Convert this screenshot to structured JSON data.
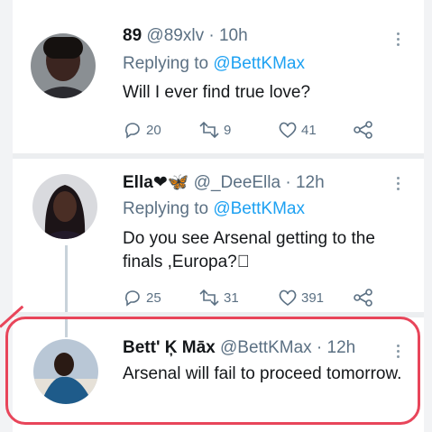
{
  "tweets": [
    {
      "name": "89",
      "handle": "@89xlv",
      "time": "10h",
      "reply_prefix": "Replying to",
      "reply_to": "@BettKMax",
      "text": "Will I ever find true love?",
      "actions": {
        "replies": "20",
        "retweets": "9",
        "likes": "41"
      }
    },
    {
      "name": "Ella",
      "name_emoji": "❤🦋",
      "handle": "@_DeeElla",
      "time": "12h",
      "reply_prefix": "Replying to",
      "reply_to": "@BettKMax",
      "text": "Do you see Arsenal getting to the finals ,Europa?\u0000",
      "actions": {
        "replies": "25",
        "retweets": "31",
        "likes": "391"
      }
    },
    {
      "name": "Bett' Ķ Māx",
      "handle": "@BettKMax",
      "time": "12h",
      "text": "Arsenal will fail to proceed tomorrow."
    }
  ],
  "separator": "·",
  "colors": {
    "link": "#1da1f2",
    "secondary": "#5b7083",
    "highlight": "#e8455a"
  },
  "icons": [
    "reply-icon",
    "retweet-icon",
    "like-icon",
    "share-icon",
    "more-icon"
  ]
}
